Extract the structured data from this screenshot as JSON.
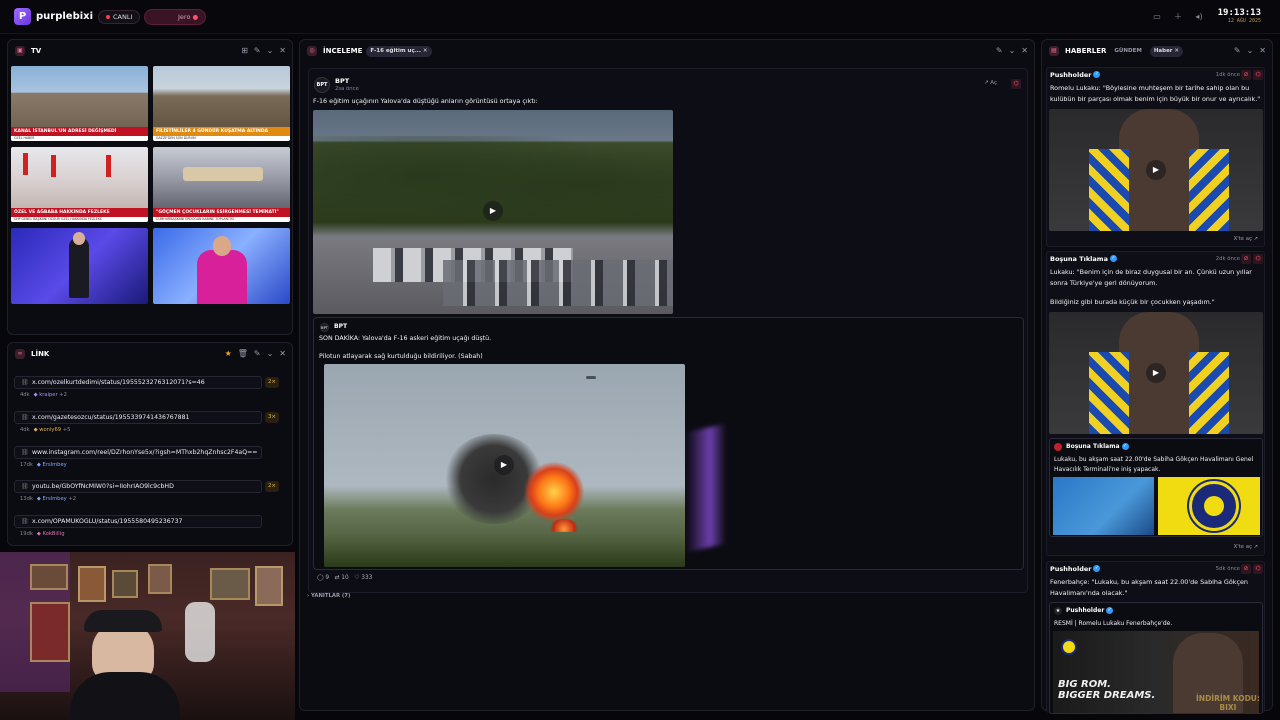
{
  "topbar": {
    "brand": "purplebixi",
    "live_label": "CANLI",
    "user_label": "Jero",
    "time": "19:13:13",
    "date": "12 AĞU 2025"
  },
  "tv": {
    "title": "TV",
    "tiles": [
      {
        "caption": "KANAL İSTANBUL'UN ADRESİ DEĞİŞMEDİ",
        "sub": "ÖZEL HABER",
        "accent": "#c01222"
      },
      {
        "caption": "FİLİSTİNLİLER 4 GÜNDÜR KUŞATMA ALTINDA",
        "sub": "GAZZE'DEN SON DURUM",
        "accent": "#e08a12"
      },
      {
        "caption": "ÖZEL VE AĞBABA HAKKINDA FEZLEKE",
        "sub": "CHP GENEL BAŞKANI ÖZGÜR ÖZEL HAKKINDA FEZLEKE",
        "accent": "#c01222"
      },
      {
        "caption": "\"GÖÇMEN ÇOCUKLARIN ESİRGENMESİ TEMİNATI\"",
        "sub": "CUMHURBAŞKANI ERDOĞAN KABİNE TOPLANTISI",
        "accent": "#c01222"
      },
      {
        "caption": "",
        "sub": "",
        "accent": "#3a3ad0"
      },
      {
        "caption": "",
        "sub": "",
        "accent": "#3a3ad0"
      }
    ]
  },
  "link": {
    "title": "LİNK",
    "items": [
      {
        "url": "x.com/ozelkurtdedimi/status/1955523276312071?s=46",
        "count": "2×",
        "age": "4dk",
        "user": "kraiper",
        "extra": "+2",
        "user_color": "#a98cf5"
      },
      {
        "url": "x.com/gazetesozcu/status/1955339741436767881",
        "count": "3×",
        "age": "4dk",
        "user": "wonly69",
        "extra": "+5",
        "user_color": "#e0b050"
      },
      {
        "url": "www.instagram.com/reel/DZrhonYse5x/?igsh=MThxb2hqZnhsc2F4aQ==",
        "count": "",
        "age": "17dk",
        "user": "Erslmbey",
        "extra": "",
        "user_color": "#7fa7ff"
      },
      {
        "url": "youtu.be/GbOYfNcMIW0?si=IIohrIAO9lc9cbHD",
        "count": "2×",
        "age": "13dk",
        "user": "Erslmbey",
        "extra": "+2",
        "user_color": "#7fa7ff"
      },
      {
        "url": "x.com/OPAMUKOGLU/status/1955580495236737",
        "count": "",
        "age": "19dk",
        "user": "KokBillig",
        "extra": "",
        "user_color": "#e070b0"
      }
    ]
  },
  "inceleme": {
    "title": "İNCELEME",
    "tag": "F-16 eğitim uç...",
    "author": "BPT",
    "author_time": "2sa önce",
    "open_label": "Aç",
    "text": "F-16 eğitim uçağının Yalova'da düştüğü anların görüntüsü ortaya çıktı:",
    "quote_author": "BPT",
    "quote_text1": "SON DAKİKA: Yalova'da F-16 askeri eğitim uçağı düştü.",
    "quote_text2": "Pilotun atlayarak sağ kurtulduğu bildiriliyor. (Sabah)",
    "stats": {
      "comments": "9",
      "reposts": "10",
      "likes": "333"
    },
    "replies_label": "YANITLAR (7)"
  },
  "haberler": {
    "title": "HABERLER",
    "tab1": "GÜNDEM",
    "tab2": "Haber",
    "posts": [
      {
        "author": "Pushholder",
        "time": "1dk önce",
        "text": "Romelu Lukaku: \"Böylesine muhteşem bir tarihe sahip olan bu kulübün bir parçası olmak benim için büyük bir onur ve ayrıcalık.\"",
        "open": "X'te aç"
      },
      {
        "author": "Boşuna Tıklama",
        "time": "2dk önce",
        "text": "Lukaku: \"Benim için de biraz duygusal bir an. Çünkü uzun yıllar sonra Türkiye'ye geri dönüyorum.",
        "text2": "Bildiğiniz gibi burada küçük bir çocukken yaşadım.\"",
        "quote_author": "Boşuna Tıklama",
        "quote_text": "Lukaku, bu akşam saat 22.00'de Sabiha Gökçen Havalimanı Genel Havacılık Terminali'ne iniş yapacak.",
        "open": "X'te aç"
      },
      {
        "author": "Pushholder",
        "time": "5dk önce",
        "text": "Fenerbahçe: \"Lukaku, bu akşam saat 22.00'de Sabiha Gökçen Havalimanı'nda olacak.\"",
        "quote_author": "Pushholder",
        "quote_text": "RESMİ | Romelu Lukaku Fenerbahçe'de.",
        "banner1": "BIG ROM.",
        "banner2": "BIGGER DREAMS."
      }
    ]
  },
  "overlay": {
    "text1": "İNDİRİM KODU:",
    "text2": "BIXI"
  },
  "colors": {
    "accent": "#a06bff",
    "live": "#ff3b4e",
    "verified": "#2f9bff"
  }
}
